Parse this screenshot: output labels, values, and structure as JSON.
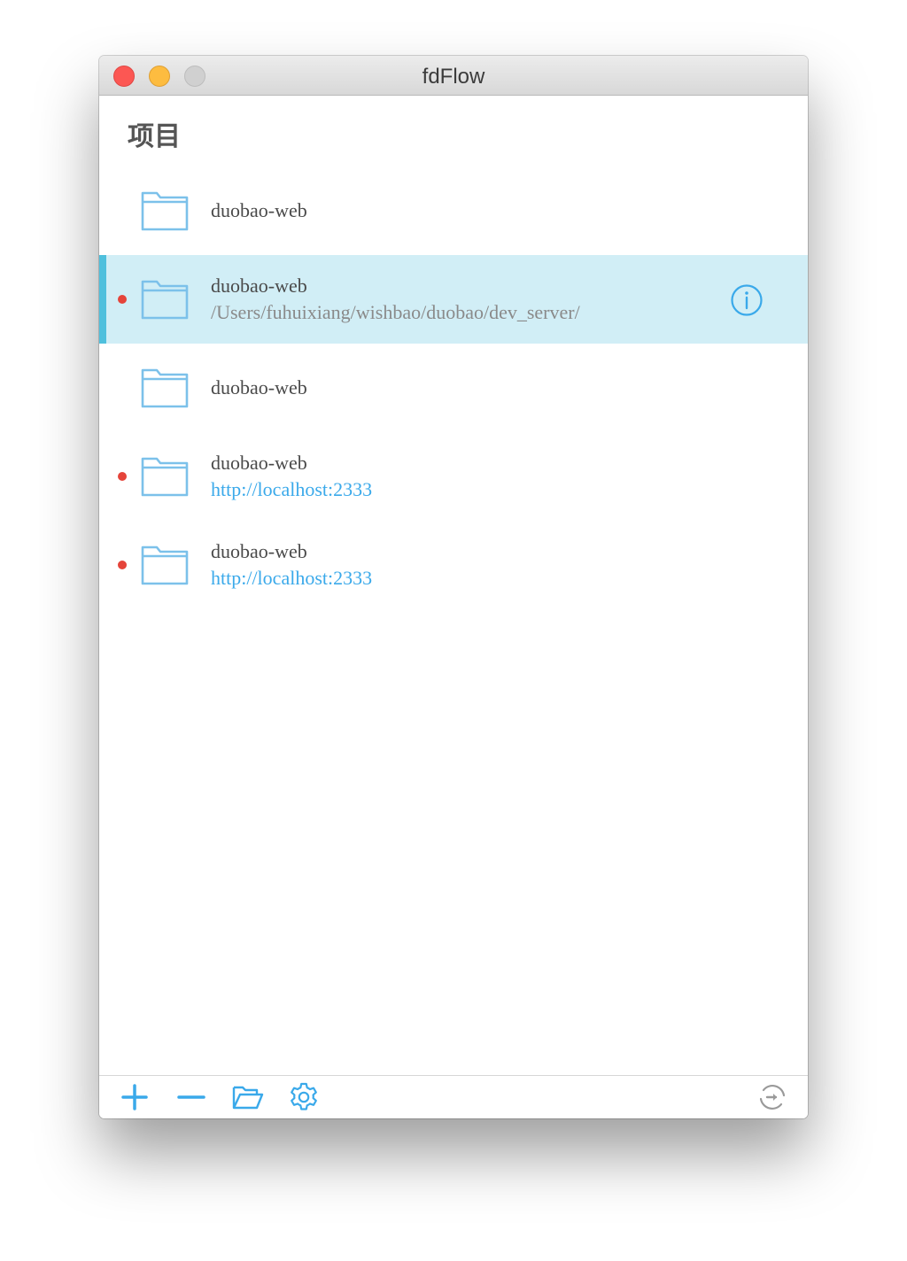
{
  "window": {
    "title": "fdFlow"
  },
  "heading": "项目",
  "projects": [
    {
      "name": "duobao-web",
      "subtitle": "",
      "subtitle_type": "none",
      "status_dot": false,
      "selected": false
    },
    {
      "name": "duobao-web",
      "subtitle": "/Users/fuhuixiang/wishbao/duobao/dev_server/",
      "subtitle_type": "path",
      "status_dot": true,
      "selected": true
    },
    {
      "name": "duobao-web",
      "subtitle": "",
      "subtitle_type": "none",
      "status_dot": false,
      "selected": false
    },
    {
      "name": "duobao-web",
      "subtitle": "http://localhost:2333",
      "subtitle_type": "url",
      "status_dot": true,
      "selected": false
    },
    {
      "name": "duobao-web",
      "subtitle": "http://localhost:2333",
      "subtitle_type": "url",
      "status_dot": true,
      "selected": false
    }
  ],
  "icons": {
    "folder": "folder-icon",
    "info": "info-icon",
    "add": "plus-icon",
    "remove": "minus-icon",
    "open": "folder-open-icon",
    "settings": "gear-icon",
    "export": "export-icon"
  },
  "colors": {
    "accent": "#3aa9ea",
    "selected_bg": "#d1eef6",
    "selected_bar": "#4fc0dd",
    "status_dot": "#e5443a",
    "folder_stroke": "#7cc1ea"
  }
}
